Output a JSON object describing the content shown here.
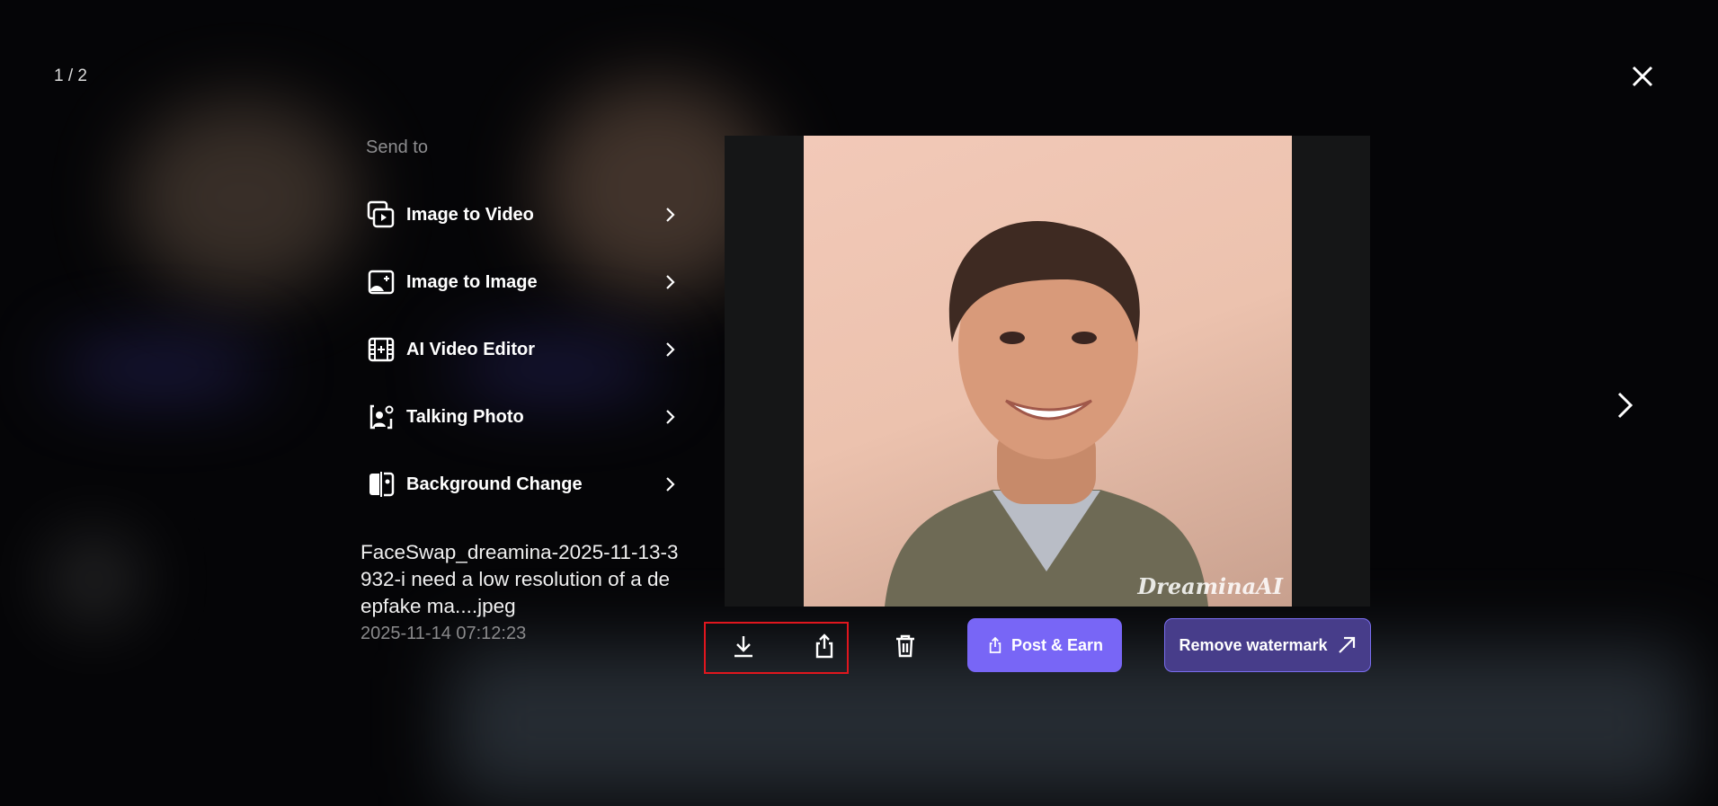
{
  "counter": "1 / 2",
  "send_to": {
    "title": "Send to",
    "items": [
      {
        "label": "Image to Video",
        "icon": "image-to-video-icon"
      },
      {
        "label": "Image to Image",
        "icon": "image-to-image-icon"
      },
      {
        "label": "AI Video Editor",
        "icon": "video-editor-icon"
      },
      {
        "label": "Talking Photo",
        "icon": "talking-photo-icon"
      },
      {
        "label": "Background Change",
        "icon": "background-change-icon"
      }
    ]
  },
  "file": {
    "name": "FaceSwap_dreamina-2025-11-13-3932-i need a low resolution of a deepfake ma....jpeg",
    "date": "2025-11-14 07:12:23"
  },
  "image": {
    "watermark": "DreaminaAI"
  },
  "actions": {
    "post": "Post & Earn",
    "remove": "Remove watermark"
  },
  "colors": {
    "accent": "#7866f6",
    "highlight": "#e0161e"
  }
}
